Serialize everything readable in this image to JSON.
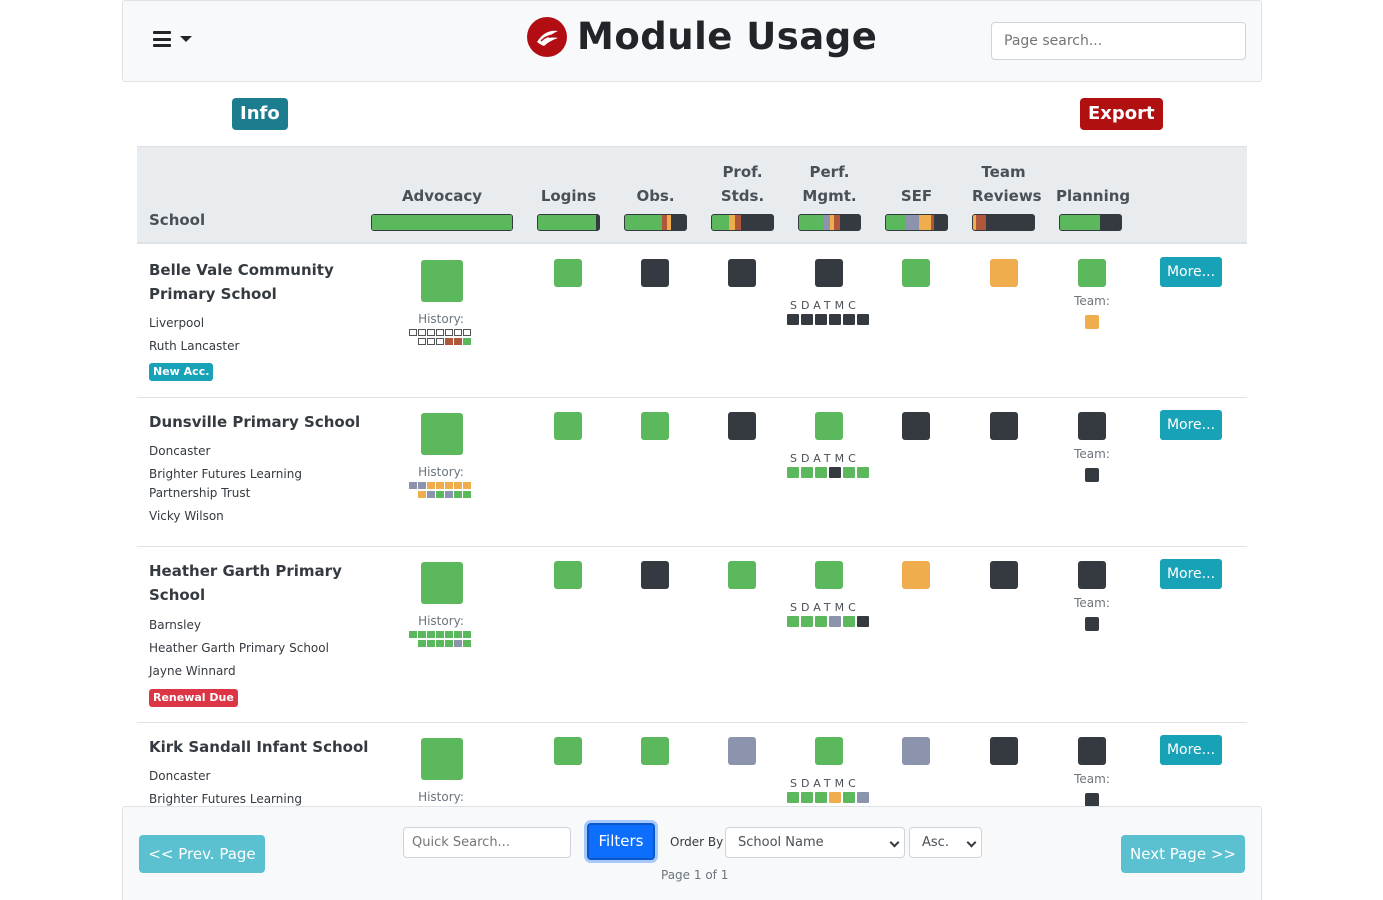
{
  "header": {
    "title": "Module Usage",
    "search_placeholder": "Page search...",
    "menu_icon": "hamburger-icon",
    "logo_icon": "logo-icon"
  },
  "actions": {
    "info": "Info",
    "export": "Export"
  },
  "columns": {
    "school": "School",
    "advocacy": "Advocacy",
    "logins": "Logins",
    "obs": "Obs.",
    "prof_1": "Prof.",
    "prof_2": "Stds.",
    "perf_1": "Perf.",
    "perf_2": "Mgmt.",
    "sef": "SEF",
    "team_1": "Team",
    "team_2": "Reviews",
    "planning": "Planning"
  },
  "colors": {
    "green": "#5cb85c",
    "dark": "#343a40",
    "amber": "#f0ad4e",
    "slate": "#8c93ad",
    "brick": "#b0573b",
    "white": "#ffffff"
  },
  "labels": {
    "history": "History:",
    "team": "Team:",
    "sdatmc": "SDATMC",
    "more": "More..."
  },
  "rows": [
    {
      "name_line1": "Belle Vale Community",
      "name_line2": "Primary School",
      "meta": [
        "Liverpool",
        "Ruth Lancaster"
      ],
      "badge": "New Acc."
    },
    {
      "name_line1": "Dunsville Primary School",
      "meta": [
        "Doncaster",
        "Brighter Futures Learning",
        "Partnership Trust",
        "Vicky Wilson"
      ]
    },
    {
      "name_line1": "Heather Garth Primary",
      "name_line2": "School",
      "meta": [
        "Barnsley",
        "Heather Garth Primary School",
        "Jayne Winnard"
      ],
      "badge": "Renewal Due"
    },
    {
      "name_line1": "Kirk Sandall Infant School",
      "meta": [
        "Doncaster",
        "Brighter Futures Learning"
      ]
    }
  ],
  "footer": {
    "prev": "<< Prev. Page",
    "next": "Next Page >>",
    "quick_search_placeholder": "Quick Search...",
    "filters": "Filters",
    "order_by_label": "Order By",
    "order_by_value": "School Name",
    "order_dir": "Asc.",
    "page_info": "Page 1 of 1"
  }
}
